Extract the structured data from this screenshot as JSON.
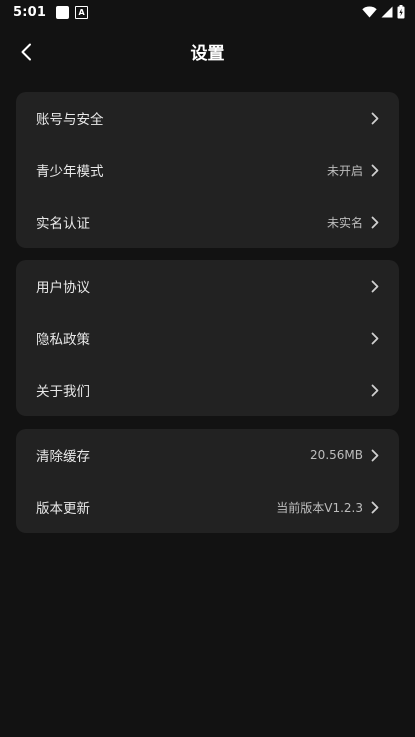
{
  "status_bar": {
    "time": "5:01",
    "notification_a_glyph": "A",
    "icons": [
      "square-notification-icon",
      "a-notification-icon",
      "wifi-icon",
      "cellular-signal-icon",
      "battery-icon"
    ]
  },
  "header": {
    "title": "设置",
    "back_icon": "chevron-left-icon"
  },
  "groups": [
    {
      "items": [
        {
          "label": "账号与安全",
          "value": ""
        },
        {
          "label": "青少年模式",
          "value": "未开启"
        },
        {
          "label": "实名认证",
          "value": "未实名"
        }
      ]
    },
    {
      "items": [
        {
          "label": "用户协议",
          "value": ""
        },
        {
          "label": "隐私政策",
          "value": ""
        },
        {
          "label": "关于我们",
          "value": ""
        }
      ]
    },
    {
      "items": [
        {
          "label": "清除缓存",
          "value": "20.56MB"
        },
        {
          "label": "版本更新",
          "value": "当前版本V1.2.3"
        }
      ]
    }
  ],
  "colors": {
    "background": "#121212",
    "card": "#222222",
    "text": "#e8e8e8",
    "secondary_text": "#bdbdbd"
  }
}
